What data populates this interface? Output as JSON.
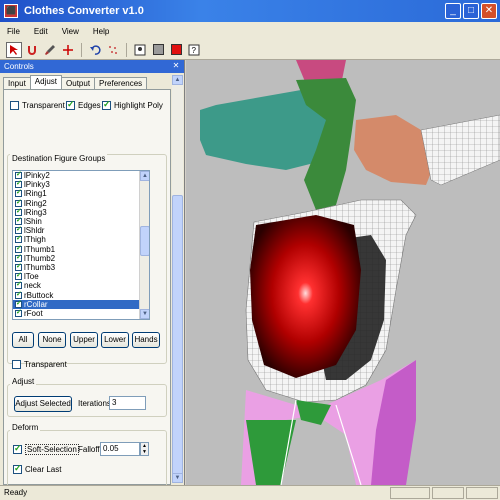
{
  "window": {
    "title": "Clothes Converter v1.0",
    "icon_name": "app-icon",
    "buttons": [
      "minimize",
      "maximize",
      "close"
    ]
  },
  "menu": [
    "File",
    "Edit",
    "View",
    "Help"
  ],
  "toolbar": {
    "tools": [
      "select-arrow-icon",
      "magnet-icon",
      "brush-icon",
      "move-axis-icon",
      "undo-icon",
      "dots-icon",
      "figure-icon",
      "gray-swatch",
      "red-swatch",
      "help-icon"
    ],
    "colors": {
      "gray": "#9a9a9a",
      "red": "#e01010"
    }
  },
  "controls": {
    "title": "Controls",
    "tabs": [
      "Input",
      "Adjust",
      "Output",
      "Preferences"
    ],
    "selected_tab": "Adjust",
    "options": {
      "transparent": "Transparent",
      "edges": "Edges",
      "highlight_poly": "Highlight Poly"
    },
    "destination_groups_label": "Destination Figure Groups",
    "groups": [
      "lPinky2",
      "lPinky3",
      "lRing1",
      "lRing2",
      "lRing3",
      "lShin",
      "lShldr",
      "lThigh",
      "lThumb1",
      "lThumb2",
      "lThumb3",
      "lToe",
      "neck",
      "rButtock",
      "rCollar",
      "rFoot"
    ],
    "selected_group": "rCollar",
    "group_buttons": [
      "All",
      "None",
      "Upper",
      "Lower",
      "Hands"
    ],
    "transparent_label": "Transparent",
    "adjust": {
      "label": "Adjust",
      "adjust_selected": "Adjust Selected",
      "iterations_label": "Iterations",
      "iterations_value": "3"
    },
    "deform": {
      "label": "Deform",
      "soft_selection": "Soft-Selection",
      "falloff_label": "Falloff",
      "falloff_value": "0.05",
      "clear_last": "Clear Last"
    }
  },
  "status": {
    "text": "Ready"
  }
}
